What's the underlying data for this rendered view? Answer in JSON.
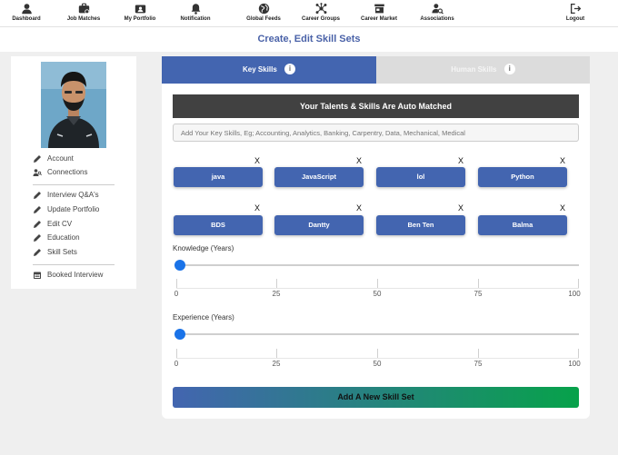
{
  "nav": {
    "dashboard": "Dashboard",
    "job_matches": "Job Matches",
    "my_portfolio": "My Portfolio",
    "notification": "Notification",
    "global_feeds": "Global Feeds",
    "career_groups": "Career Groups",
    "career_market": "Career Market",
    "associations": "Associations",
    "logout": "Logout"
  },
  "page_title": "Create, Edit Skill Sets",
  "sidebar": {
    "items": [
      {
        "label": "Account",
        "icon": "pencil-icon"
      },
      {
        "label": "Connections",
        "icon": "people-icon"
      },
      {
        "label": "Interview Q&A's",
        "icon": "pencil-icon"
      },
      {
        "label": "Update Portfolio",
        "icon": "pencil-icon"
      },
      {
        "label": "Edit CV",
        "icon": "pencil-icon"
      },
      {
        "label": "Education",
        "icon": "pencil-icon"
      },
      {
        "label": "Skill Sets",
        "icon": "pencil-icon"
      },
      {
        "label": "Booked Interview",
        "icon": "calendar-icon"
      }
    ]
  },
  "tabs": {
    "key_skills": "Key Skills",
    "human_skills": "Human Skills",
    "info_glyph": "i"
  },
  "banner": "Your Talents & Skills Are Auto Matched",
  "skill_input": {
    "placeholder": "Add Your Key Skills, Eg; Accounting, Analytics, Banking, Carpentry, Data, Mechanical, Medical",
    "value": ""
  },
  "skills": [
    "java",
    "JavaScript",
    "lol",
    "Python",
    "BDS",
    "Dantty",
    "Ben Ten",
    "Balma"
  ],
  "remove_glyph": "X",
  "knowledge": {
    "label": "Knowledge (Years)",
    "value": 0,
    "min": 0,
    "max": 100,
    "ticks": [
      "0",
      "25",
      "50",
      "75",
      "100"
    ]
  },
  "experience": {
    "label": "Experience (Years)",
    "value": 0,
    "min": 0,
    "max": 100,
    "ticks": [
      "0",
      "25",
      "50",
      "75",
      "100"
    ]
  },
  "add_button": "Add A New Skill Set",
  "colors": {
    "accent": "#4365b0",
    "banner": "#414141",
    "slider": "#1a73e8",
    "button_gradient_end": "#07a24a",
    "title": "#4a62a8"
  }
}
